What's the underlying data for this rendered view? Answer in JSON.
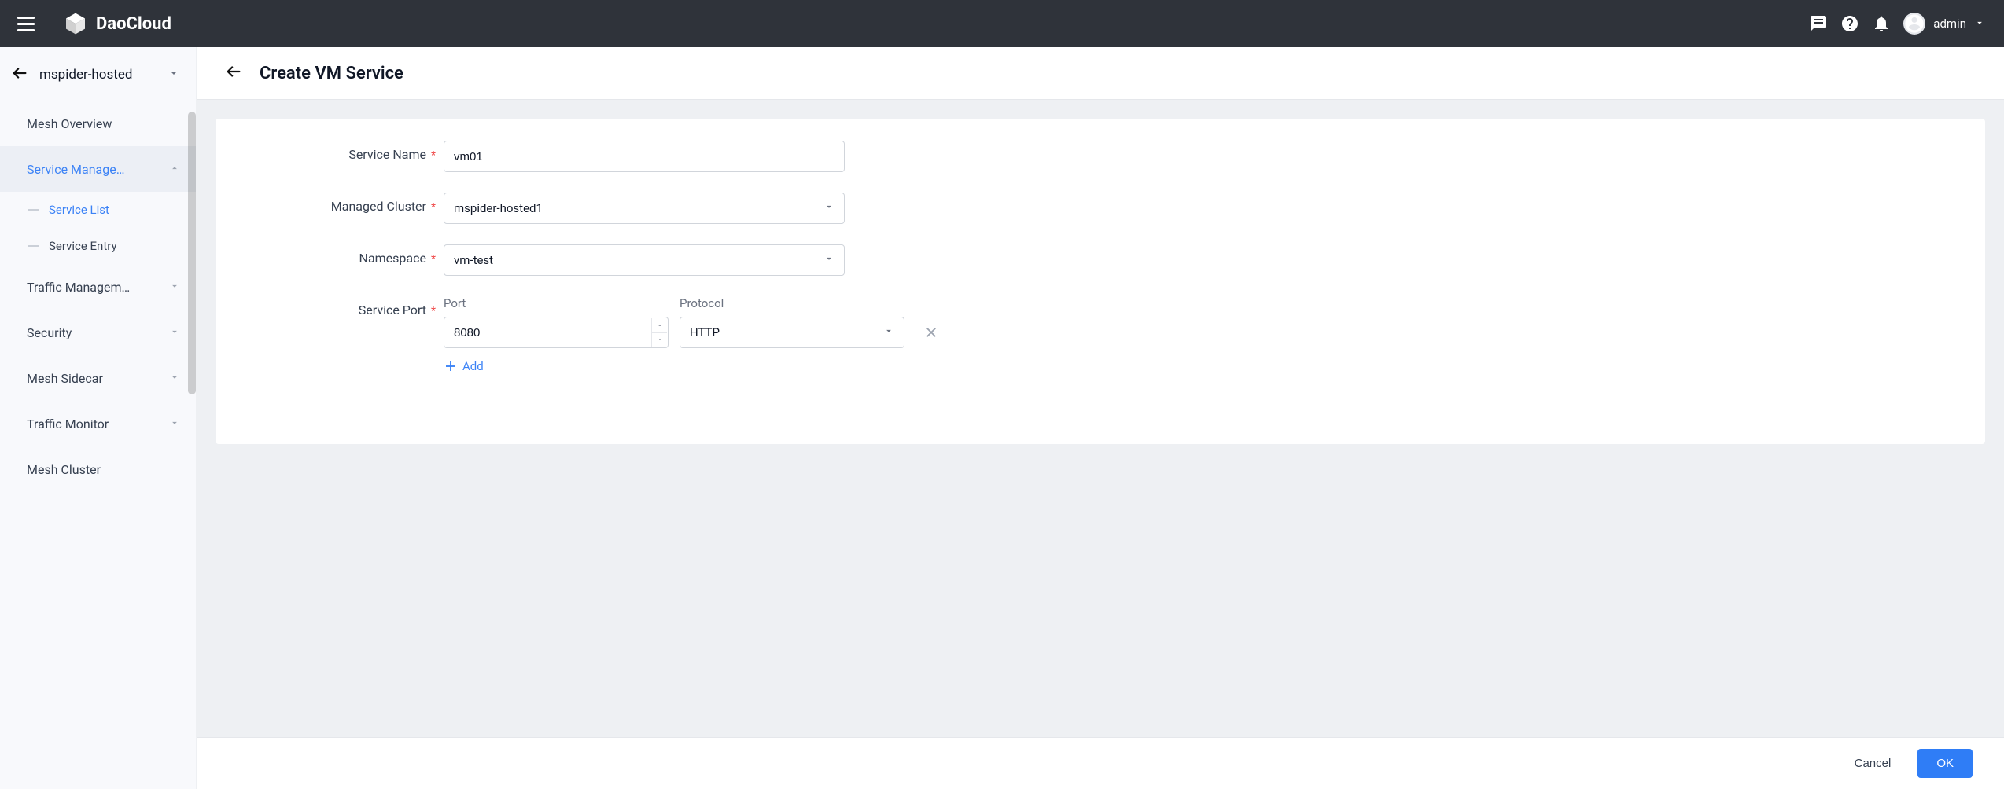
{
  "header": {
    "brand": "DaoCloud",
    "user": "admin"
  },
  "sidebar": {
    "mesh_name": "mspider-hosted",
    "items": [
      {
        "label": "Mesh Overview",
        "expandable": false
      },
      {
        "label": "Service Manage…",
        "expandable": true,
        "active": true
      },
      {
        "label": "Traffic Managem…",
        "expandable": true
      },
      {
        "label": "Security",
        "expandable": true
      },
      {
        "label": "Mesh Sidecar",
        "expandable": true
      },
      {
        "label": "Traffic Monitor",
        "expandable": true
      },
      {
        "label": "Mesh Cluster",
        "expandable": false
      }
    ],
    "service_sub": [
      {
        "label": "Service List",
        "active": true
      },
      {
        "label": "Service Entry",
        "active": false
      }
    ]
  },
  "page": {
    "title": "Create VM Service"
  },
  "form": {
    "service_name_label": "Service Name",
    "service_name_value": "vm01",
    "managed_cluster_label": "Managed Cluster",
    "managed_cluster_value": "mspider-hosted1",
    "namespace_label": "Namespace",
    "namespace_value": "vm-test",
    "service_port_label": "Service Port",
    "port_col_label": "Port",
    "protocol_col_label": "Protocol",
    "ports": [
      {
        "port": "8080",
        "protocol": "HTTP"
      }
    ],
    "add_label": "Add"
  },
  "footer": {
    "cancel": "Cancel",
    "ok": "OK"
  }
}
